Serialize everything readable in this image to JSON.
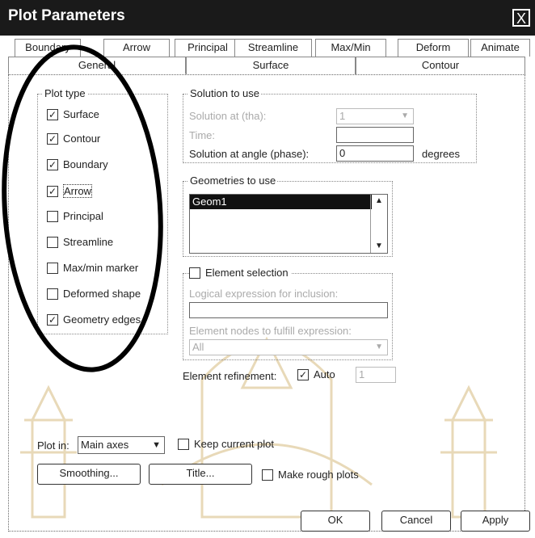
{
  "window": {
    "title": "Plot Parameters",
    "close_label": "X"
  },
  "tabs_row1": [
    {
      "label": "Boundary"
    },
    {
      "label": "Arrow"
    },
    {
      "label": "Principal"
    },
    {
      "label": "Streamline"
    },
    {
      "label": "Max/Min"
    },
    {
      "label": "Deform"
    },
    {
      "label": "Animate"
    }
  ],
  "tabs_row2": [
    {
      "label": "General"
    },
    {
      "label": "Surface"
    },
    {
      "label": "Contour"
    }
  ],
  "plot_type": {
    "legend": "Plot type",
    "items": [
      {
        "label": "Surface",
        "checked": true
      },
      {
        "label": "Contour",
        "checked": true
      },
      {
        "label": "Boundary",
        "checked": true
      },
      {
        "label": "Arrow",
        "checked": true
      },
      {
        "label": "Principal",
        "checked": false
      },
      {
        "label": "Streamline",
        "checked": false
      },
      {
        "label": "Max/min marker",
        "checked": false
      },
      {
        "label": "Deformed shape",
        "checked": false
      },
      {
        "label": "Geometry edges",
        "checked": true
      }
    ]
  },
  "solution": {
    "legend": "Solution to use",
    "phase_label": "Solution at (tha):",
    "phase_value": "1",
    "time_label": "Time:",
    "time_value": "",
    "angle_label": "Solution at angle (phase):",
    "angle_value": "0",
    "angle_unit": "degrees"
  },
  "geometries": {
    "legend": "Geometries to use",
    "items": [
      "Geom1"
    ]
  },
  "element_selection": {
    "label": "Element selection",
    "checked": false,
    "expr_label": "Logical expression for inclusion:",
    "expr_value": "",
    "nodes_label": "Element nodes to fulfill expression:",
    "nodes_value": "All"
  },
  "refinement": {
    "label": "Element refinement:",
    "auto_label": "Auto",
    "auto_checked": true,
    "value": "1"
  },
  "plot_in": {
    "label": "Plot in:",
    "value": "Main axes",
    "keep_label": "Keep current plot",
    "keep_checked": false
  },
  "buttons": {
    "smoothing": "Smoothing...",
    "title": "Title...",
    "rough_label": "Make rough plots",
    "rough_checked": false,
    "ok": "OK",
    "cancel": "Cancel",
    "apply": "Apply"
  },
  "colors": {
    "titlebar": "#1a1a1a",
    "annotation_oval": "#000000",
    "watermark": "#e8d9b8"
  }
}
